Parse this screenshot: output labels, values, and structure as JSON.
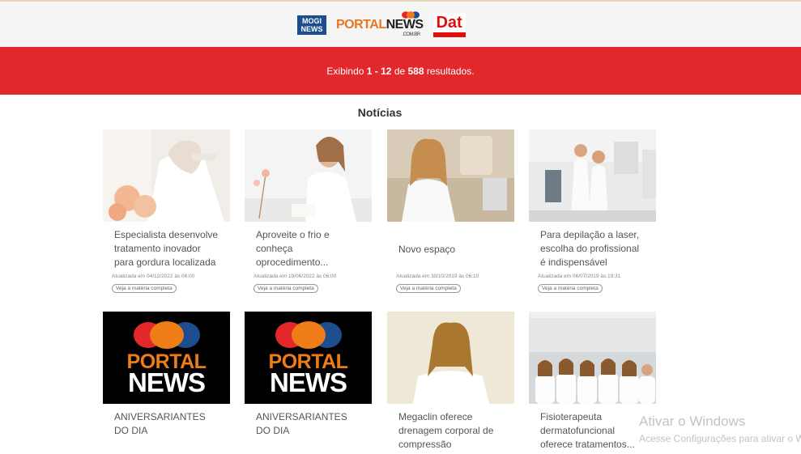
{
  "header": {
    "logo_mogi": "MOGI NEWS",
    "logo_portal_a": "PORTAL",
    "logo_portal_b": "NEWS",
    "logo_portal_sub": ".COM.BR",
    "logo_dat": "Dat"
  },
  "results": {
    "prefix": "Exibindo ",
    "range": "1 - 12",
    "mid": " de ",
    "total": "588",
    "suffix": " resultados."
  },
  "section_title": "Notícias",
  "cards": [
    {
      "title": "Especialista desenvolve tratamento inovador para gordura localizada",
      "date": "Atualizada em 04/12/2022 às 06:00",
      "more": "Veja a matéria completa"
    },
    {
      "title": "Aproveite o frio e conheça oprocedimento...",
      "date": "Atualizada em 19/06/2022 às 06:00",
      "more": "Veja a matéria completa"
    },
    {
      "title": "Novo espaço",
      "date": "Atualizada em 30/10/2019 às 06:10",
      "more": "Veja a matéria completa"
    },
    {
      "title": "Para depilação a laser, escolha do profissional é indispensável",
      "date": "Atualizada em 06/07/2019 às 19:31",
      "more": "Veja a matéria completa"
    },
    {
      "title": "ANIVERSARIANTES DO DIA"
    },
    {
      "title": "ANIVERSARIANTES DO DIA"
    },
    {
      "title": "Megaclin oferece drenagem corporal de compressão"
    },
    {
      "title": "Fisioterapeuta dermatofuncional oferece tratamentos..."
    }
  ],
  "portal_logo": {
    "line1": "PORTAL",
    "line2": "NEWS"
  },
  "watermark": {
    "line1": "Ativar o Windows",
    "line2": "Acesse Configurações para ativar o Windows."
  },
  "colors": {
    "accent_red": "#e3282b",
    "portal_orange": "#ef7d17"
  }
}
